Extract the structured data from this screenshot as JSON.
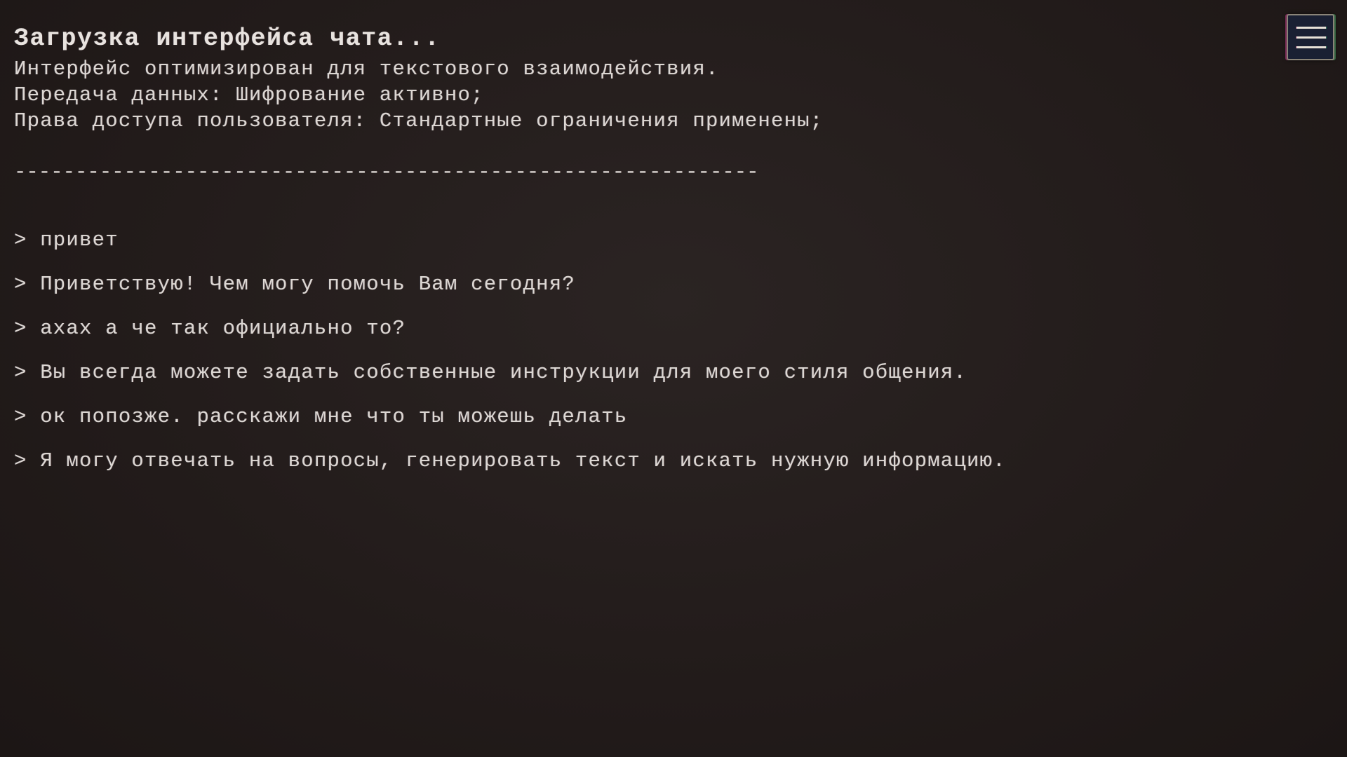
{
  "header": {
    "title": "Загрузка интерфейса чата...",
    "lines": [
      "Интерфейс оптимизирован для текстового взаимодействия.",
      "Передача данных: Шифрование активно;",
      "Права доступа пользователя: Стандартные ограничения применены;"
    ],
    "divider": "-------------------------------------------------------------"
  },
  "chat": {
    "messages": [
      "> привет",
      "> Приветствую! Чем могу помочь Вам сегодня?",
      "> ахах а че так официально то?",
      "> Вы всегда можете задать собственные инструкции для моего стиля общения.",
      "> ок попозже. расскажи мне что ты можешь делать",
      "> Я могу отвечать на вопросы, генерировать текст и искать нужную информацию."
    ]
  },
  "menu": {
    "icon": "hamburger-menu-icon"
  },
  "colors": {
    "background": "#231c1b",
    "text": "#dcd7d3",
    "menu_fill": "#1a2033"
  }
}
